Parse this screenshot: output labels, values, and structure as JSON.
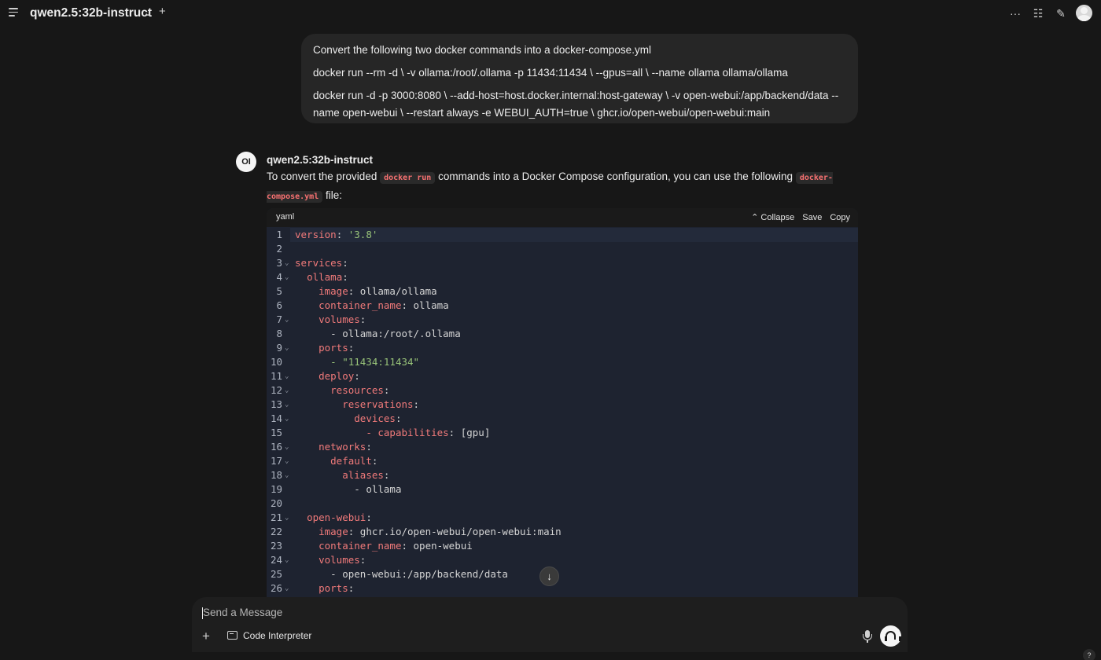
{
  "header": {
    "model_name": "qwen2.5:32b-instruct",
    "caret": "⌄",
    "add": "+"
  },
  "toolbar": {
    "more": "···",
    "controls": "☷",
    "new_chat": "✎"
  },
  "user_message": {
    "lines": [
      "Convert the following two docker commands into a docker-compose.yml",
      "docker run --rm -d \\ -v ollama:/root/.ollama -p 11434:11434 \\ --gpus=all \\ --name ollama ollama/ollama",
      "docker run -d -p 3000:8080 \\ --add-host=host.docker.internal:host-gateway \\ -v open-webui:/app/backend/data --name open-webui \\ --restart always -e WEBUI_AUTH=true \\ ghcr.io/open-webui/open-webui:main"
    ]
  },
  "assistant": {
    "logo": "OI",
    "name": "qwen2.5:32b-instruct",
    "text_before": "To convert the provided ",
    "code_1": "docker run",
    "text_mid": " commands into a Docker Compose configuration, you can use the following ",
    "code_2": "docker-compose.yml",
    "text_after": " file:"
  },
  "code_block": {
    "language": "yaml",
    "actions": {
      "collapse": "⌃ Collapse",
      "save": "Save",
      "copy": "Copy"
    },
    "lines": [
      {
        "n": "1",
        "fold": false,
        "indent": "",
        "key": "version",
        "value": " '3.8'",
        "vtype": "s"
      },
      {
        "n": "2",
        "fold": false,
        "indent": "",
        "key": "",
        "value": "",
        "vtype": "v"
      },
      {
        "n": "3",
        "fold": true,
        "indent": "",
        "key": "services",
        "value": "",
        "vtype": "v"
      },
      {
        "n": "4",
        "fold": true,
        "indent": "  ",
        "key": "ollama",
        "value": "",
        "vtype": "v"
      },
      {
        "n": "5",
        "fold": false,
        "indent": "    ",
        "key": "image",
        "value": " ollama/ollama",
        "vtype": "v"
      },
      {
        "n": "6",
        "fold": false,
        "indent": "    ",
        "key": "container_name",
        "value": " ollama",
        "vtype": "v"
      },
      {
        "n": "7",
        "fold": true,
        "indent": "    ",
        "key": "volumes",
        "value": "",
        "vtype": "v"
      },
      {
        "n": "8",
        "fold": false,
        "indent": "      ",
        "key": "",
        "value": "- ollama:/root/.ollama",
        "vtype": "v"
      },
      {
        "n": "9",
        "fold": true,
        "indent": "    ",
        "key": "ports",
        "value": "",
        "vtype": "v"
      },
      {
        "n": "10",
        "fold": false,
        "indent": "      ",
        "key": "",
        "value": "- \"11434:11434\"",
        "vtype": "s"
      },
      {
        "n": "11",
        "fold": true,
        "indent": "    ",
        "key": "deploy",
        "value": "",
        "vtype": "v"
      },
      {
        "n": "12",
        "fold": true,
        "indent": "      ",
        "key": "resources",
        "value": "",
        "vtype": "v"
      },
      {
        "n": "13",
        "fold": true,
        "indent": "        ",
        "key": "reservations",
        "value": "",
        "vtype": "v"
      },
      {
        "n": "14",
        "fold": true,
        "indent": "          ",
        "key": "devices",
        "value": "",
        "vtype": "v"
      },
      {
        "n": "15",
        "fold": false,
        "indent": "            ",
        "key": "- capabilities",
        "value": " [gpu]",
        "vtype": "v"
      },
      {
        "n": "16",
        "fold": true,
        "indent": "    ",
        "key": "networks",
        "value": "",
        "vtype": "v"
      },
      {
        "n": "17",
        "fold": true,
        "indent": "      ",
        "key": "default",
        "value": "",
        "vtype": "v"
      },
      {
        "n": "18",
        "fold": true,
        "indent": "        ",
        "key": "aliases",
        "value": "",
        "vtype": "v"
      },
      {
        "n": "19",
        "fold": false,
        "indent": "          ",
        "key": "",
        "value": "- ollama",
        "vtype": "v"
      },
      {
        "n": "20",
        "fold": false,
        "indent": "",
        "key": "",
        "value": "",
        "vtype": "v"
      },
      {
        "n": "21",
        "fold": true,
        "indent": "  ",
        "key": "open-webui",
        "value": "",
        "vtype": "v"
      },
      {
        "n": "22",
        "fold": false,
        "indent": "    ",
        "key": "image",
        "value": " ghcr.io/open-webui/open-webui:main",
        "vtype": "v"
      },
      {
        "n": "23",
        "fold": false,
        "indent": "    ",
        "key": "container_name",
        "value": " open-webui",
        "vtype": "v"
      },
      {
        "n": "24",
        "fold": true,
        "indent": "    ",
        "key": "volumes",
        "value": "",
        "vtype": "v"
      },
      {
        "n": "25",
        "fold": false,
        "indent": "      ",
        "key": "",
        "value": "- open-webui:/app/backend/data",
        "vtype": "v"
      },
      {
        "n": "26",
        "fold": true,
        "indent": "    ",
        "key": "ports",
        "value": "",
        "vtype": "v"
      }
    ]
  },
  "scroll_down": "↓",
  "composer": {
    "placeholder": "Send a Message",
    "add": "+",
    "code_interpreter": "Code Interpreter"
  },
  "help": "?"
}
